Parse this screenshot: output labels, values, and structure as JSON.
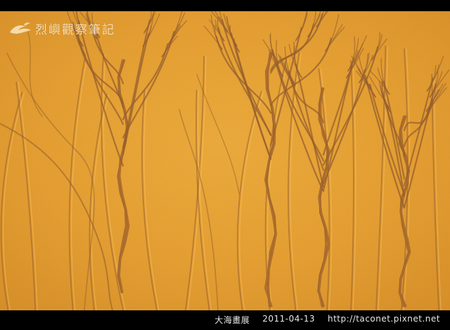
{
  "photo": {
    "subject": "sand-erosion-patterns",
    "colors": {
      "sand_light": "#f0ab38",
      "sand_mid": "#e09a2b",
      "sand_dark": "#b9712a",
      "ridge": "#8f5a2e",
      "frame": "#000000"
    }
  },
  "watermark": {
    "text": "烈嶼觀察筆記",
    "logo_icon": "bird-logo-icon"
  },
  "caption": {
    "title": "大海畫展",
    "date": "2011-04-13",
    "url": "http://taconet.pixnet.net"
  }
}
